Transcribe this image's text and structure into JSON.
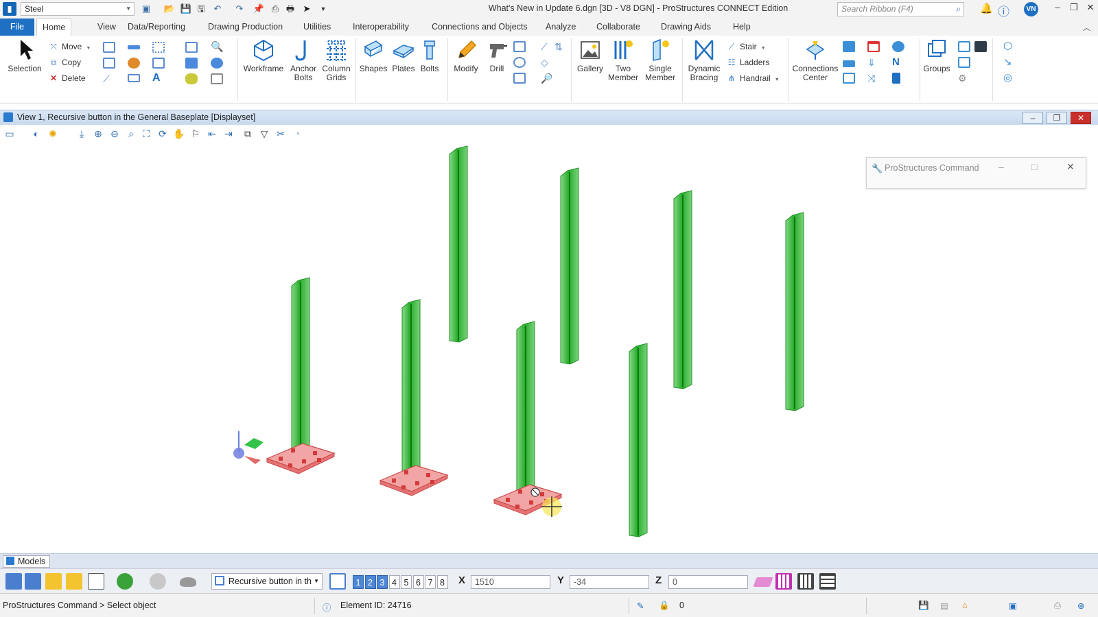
{
  "titlebar": {
    "workflow": "Steel",
    "window_title": "What's New in Update 6.dgn [3D - V8 DGN] - ProStructures CONNECT Edition",
    "search_placeholder": "Search Ribbon (F4)",
    "user_initials": "VN"
  },
  "tabs": [
    "File",
    "Home",
    "View",
    "Data/Reporting",
    "Drawing Production",
    "Utilities",
    "Interoperability",
    "Connections and Objects",
    "Analyze",
    "Collaborate",
    "Drawing Aids",
    "Help"
  ],
  "ribbon": {
    "groups": "Groups",
    "selection": "Selection",
    "move": "Move",
    "copy": "Copy",
    "delete": "Delete",
    "workframe": "Workframe",
    "anchor_bolts_1": "Anchor",
    "anchor_bolts_2": "Bolts",
    "column_grids_1": "Column",
    "column_grids_2": "Grids",
    "shapes": "Shapes",
    "plates": "Plates",
    "bolts": "Bolts",
    "modify": "Modify",
    "drill": "Drill",
    "gallery": "Gallery",
    "two_member_1": "Two",
    "two_member_2": "Member",
    "single_member_1": "Single",
    "single_member_2": "Member",
    "dynamic_bracing_1": "Dynamic",
    "dynamic_bracing_2": "Bracing",
    "stair": "Stair",
    "ladders": "Ladders",
    "handrail": "Handrail",
    "connections_center_1": "Connections",
    "connections_center_2": "Center"
  },
  "view": {
    "title": "View 1, Recursive button in the General Baseplate [Displayset]"
  },
  "command_dialog": {
    "title": "ProStructures Command"
  },
  "models_tab": "Models",
  "bottom": {
    "view_select": "Recursive button in th",
    "view_numbers": [
      "1",
      "2",
      "3",
      "4",
      "5",
      "6",
      "7",
      "8"
    ],
    "active_views": [
      1,
      2,
      3
    ],
    "x_label": "X",
    "x_value": "1510",
    "y_label": "Y",
    "y_value": "-34",
    "z_label": "Z",
    "z_value": "0"
  },
  "status": {
    "prompt": "ProStructures Command >  Select object",
    "element_id": "Element ID: 24716",
    "lock_count": "0"
  },
  "colors": {
    "accent": "#1f6fc3",
    "column_green": "#22b024",
    "baseplate_red": "#e57373"
  }
}
